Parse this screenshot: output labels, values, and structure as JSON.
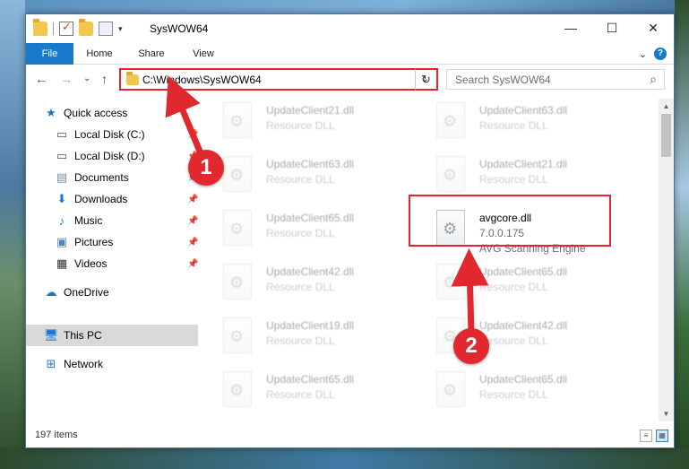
{
  "window": {
    "title": "SysWOW64",
    "minimize": "—",
    "maximize": "☐",
    "close": "✕"
  },
  "ribbon": {
    "tabs": [
      "File",
      "Home",
      "Share",
      "View"
    ],
    "expand": "⌄",
    "help": "?"
  },
  "nav": {
    "back": "←",
    "forward": "→",
    "recent": "⌄",
    "up": "↑",
    "address": "C:\\Windows\\SysWOW64",
    "address_dropdown": "⌄",
    "refresh": "↻",
    "search_placeholder": "Search SysWOW64",
    "search_icon": "⌕"
  },
  "sidebar": {
    "items": [
      {
        "label": "Quick access",
        "icon": "star-icon",
        "pinned": false
      },
      {
        "label": "Local Disk (C:)",
        "icon": "drive-icon",
        "pinned": true
      },
      {
        "label": "Local Disk (D:)",
        "icon": "drive-icon",
        "pinned": true
      },
      {
        "label": "Documents",
        "icon": "documents-icon",
        "pinned": true
      },
      {
        "label": "Downloads",
        "icon": "download-icon",
        "pinned": true
      },
      {
        "label": "Music",
        "icon": "music-icon",
        "pinned": true
      },
      {
        "label": "Pictures",
        "icon": "pictures-icon",
        "pinned": true
      },
      {
        "label": "Videos",
        "icon": "videos-icon",
        "pinned": true
      },
      {
        "label": "OneDrive",
        "icon": "cloud-icon",
        "pinned": false
      },
      {
        "label": "This PC",
        "icon": "computer-icon",
        "pinned": false
      },
      {
        "label": "Network",
        "icon": "network-icon",
        "pinned": false
      }
    ]
  },
  "files": [
    {
      "name": "UpdateClient21.dll",
      "desc": "Resource DLL"
    },
    {
      "name": "UpdateClient63.dll",
      "desc": "Resource DLL"
    },
    {
      "name": "UpdateClient63.dll",
      "desc": "Resource DLL"
    },
    {
      "name": "UpdateClient21.dll",
      "desc": "Resource DLL"
    },
    {
      "name": "UpdateClient65.dll",
      "desc": "Resource DLL"
    },
    {
      "name": "avgcore.dll",
      "desc": "7.0.0.175",
      "desc2": "AVG Scanning Engine"
    },
    {
      "name": "UpdateClient42.dll",
      "desc": "Resource DLL"
    },
    {
      "name": "UpdateClient65.dll",
      "desc": "Resource DLL"
    },
    {
      "name": "UpdateClient19.dll",
      "desc": "Resource DLL"
    },
    {
      "name": "UpdateClient42.dll",
      "desc": "Resource DLL"
    },
    {
      "name": "UpdateClient65.dll",
      "desc": "Resource DLL"
    },
    {
      "name": "UpdateClient65.dll",
      "desc": "Resource DLL"
    }
  ],
  "status": {
    "items_count": "197 items"
  },
  "annotations": {
    "step1": "1",
    "step2": "2",
    "color": "#e2282f"
  }
}
